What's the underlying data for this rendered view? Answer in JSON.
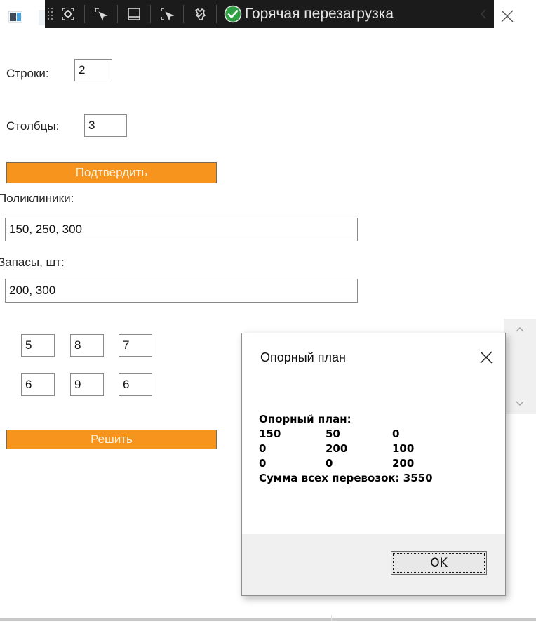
{
  "window": {
    "toolbar": {
      "icons": [
        "select-element-icon",
        "pointer-select-icon",
        "layout-adorner-icon",
        "track-focus-icon",
        "display-settings-icon",
        "hot-reload-ok-icon"
      ],
      "hot_reload_label": "Горячая перезагрузка"
    }
  },
  "form": {
    "rows_label": "Строки:",
    "rows_value": "2",
    "cols_label": "Столбцы:",
    "cols_value": "3",
    "confirm_label": "Подтвердить",
    "clinics_label": "Поликлиники:",
    "clinics_value": "150, 250, 300",
    "stock_label": "Запасы, шт:",
    "stock_value": "200, 300",
    "matrix": [
      [
        "5",
        "8",
        "7"
      ],
      [
        "6",
        "9",
        "6"
      ]
    ],
    "solve_label": "Решить"
  },
  "dialog": {
    "title": "Опорный план",
    "heading": "Опорный план:",
    "plan": [
      [
        "150",
        "50",
        "0"
      ],
      [
        "0",
        "200",
        "100"
      ],
      [
        "0",
        "0",
        "200"
      ]
    ],
    "summary": "Сумма всех перевозок: 3550",
    "ok_label": "OK"
  },
  "colors": {
    "accent_orange": "#f7941d",
    "button_text": "#faf1de",
    "toolbar_bg": "#1b1b1b",
    "hot_reload_ok": "#2ea043"
  }
}
